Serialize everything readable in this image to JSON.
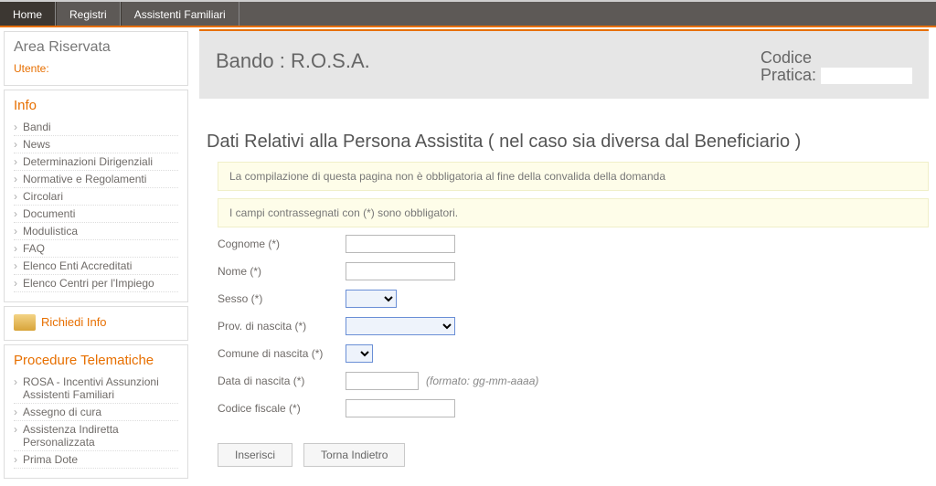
{
  "topbar": {
    "home": "Home",
    "registri": "Registri",
    "assistenti": "Assistenti Familiari"
  },
  "sidebar": {
    "area_riservata": "Area Riservata",
    "utente_label": "Utente:",
    "utente_value": "",
    "info_title": "Info",
    "info_items": [
      "Bandi",
      "News",
      "Determinazioni Dirigenziali",
      "Normative e Regolamenti",
      "Circolari",
      "Documenti",
      "Modulistica",
      "FAQ",
      "Elenco Enti Accreditati",
      "Elenco Centri per l'Impiego"
    ],
    "richiedi_info": "Richiedi Info",
    "procedure_title": "Procedure Telematiche",
    "procedure_items": [
      "ROSA - Incentivi Assunzioni Assistenti Familiari",
      "Assegno di cura",
      "Assistenza Indiretta Personalizzata",
      "Prima Dote"
    ]
  },
  "header": {
    "bando": "Bando : R.O.S.A.",
    "codice_label1": "Codice",
    "codice_label2": "Pratica:",
    "codice_value": ""
  },
  "main": {
    "title": "Dati Relativi alla Persona Assistita ( nel caso sia diversa dal Beneficiario )",
    "notice1": "La compilazione di questa pagina non è obbligatoria al fine della convalida della domanda",
    "notice2": "I campi contrassegnati con (*) sono obbligatori.",
    "labels": {
      "cognome": "Cognome (*)",
      "nome": "Nome (*)",
      "sesso": "Sesso (*)",
      "prov": "Prov. di nascita (*)",
      "comune": "Comune di nascita (*)",
      "data": "Data di nascita (*)",
      "cf": "Codice fiscale (*)"
    },
    "date_hint": "(formato: gg-mm-aaaa)",
    "values": {
      "cognome": "",
      "nome": "",
      "sesso": "",
      "prov": "",
      "comune": "",
      "data": "",
      "cf": ""
    },
    "buttons": {
      "inserisci": "Inserisci",
      "indietro": "Torna Indietro"
    }
  }
}
